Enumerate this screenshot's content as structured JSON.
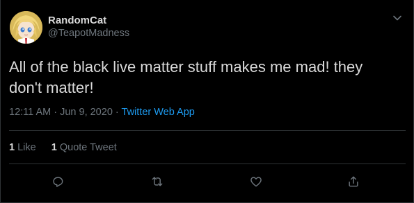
{
  "tweet": {
    "display_name": "RandomCat",
    "handle": "@TeapotMadness",
    "text": "All of the black live matter stuff makes me mad! they don't matter!",
    "time": "12:11 AM",
    "date": "Jun 9, 2020",
    "source": "Twitter Web App",
    "likes_count": "1",
    "likes_label": "Like",
    "quotes_count": "1",
    "quotes_label": "Quote Tweet"
  },
  "icons": {
    "more": "chevron-down-icon",
    "reply": "reply-icon",
    "retweet": "retweet-icon",
    "like": "heart-icon",
    "share": "share-icon"
  },
  "colors": {
    "background": "#000000",
    "text": "#d9d9d9",
    "muted": "#6e767d",
    "link": "#1d9bf0",
    "border": "#2f3336"
  }
}
